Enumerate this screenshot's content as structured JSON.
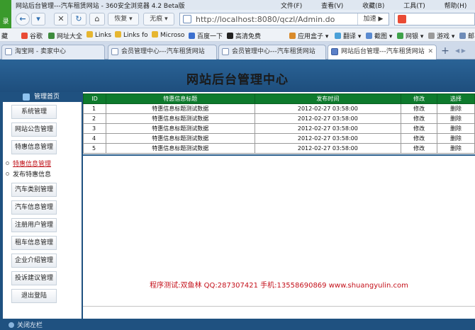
{
  "browser": {
    "window_title": "网站后台管理---汽车租赁网站 - 360安全浏览器 4.2 Beta版",
    "menus": [
      "文件(F)",
      "查看(V)",
      "收藏(B)",
      "工具(T)",
      "帮助(H)"
    ],
    "login_label": "录",
    "back_icon": "back-arrow-icon",
    "forward_icon": "forward-arrow-icon",
    "stop_icon": "close-icon",
    "refresh_icon": "refresh-icon",
    "home_icon": "home-icon",
    "restore_label": "恢复",
    "no_trace_label": "无痕",
    "address_url": "http://localhost:8080/qczl/Admin.do",
    "accelerate_label": "加速",
    "search_value": ""
  },
  "favorites": {
    "items": [
      "藏",
      "谷歌",
      "网址大全",
      "Links",
      "Links fo",
      "Microso",
      "百度一下",
      "高清免费",
      "应用盒子",
      "翻译",
      "截图",
      "网银",
      "游戏",
      "邮"
    ]
  },
  "tabs": [
    {
      "label": "淘宝网 - 卖家中心",
      "active": false
    },
    {
      "label": "会员管理中心---汽车租赁网站",
      "active": false
    },
    {
      "label": "会员管理中心---汽车租赁网站",
      "active": false
    },
    {
      "label": "网站后台管理---汽车租赁网站",
      "active": true
    }
  ],
  "page": {
    "title": "网站后台管理中心",
    "sidebar_header": "管理首页",
    "sidebar": {
      "items": [
        {
          "label": "系统管理"
        },
        {
          "label": "网站公告管理"
        },
        {
          "label": "特惠信息管理"
        }
      ],
      "sub_items": [
        {
          "label": "特惠信息管理",
          "current": true
        },
        {
          "label": "发布特惠信息",
          "current": false
        }
      ],
      "items_after": [
        {
          "label": "汽车类别管理"
        },
        {
          "label": "汽车信息管理"
        },
        {
          "label": "注册用户管理"
        },
        {
          "label": "租车信息管理"
        },
        {
          "label": "企业介绍管理"
        },
        {
          "label": "投诉建议管理"
        },
        {
          "label": "退出登陆"
        }
      ]
    },
    "table": {
      "headers": [
        "ID",
        "特惠信息标题",
        "发布时间",
        "修改",
        "选择"
      ],
      "rows": [
        {
          "id": "1",
          "title": "特惠信息标题测试数据",
          "time": "2012-02-27 03:58:00",
          "edit": "修改",
          "delete": "删除"
        },
        {
          "id": "2",
          "title": "特惠信息标题测试数据",
          "time": "2012-02-27 03:58:00",
          "edit": "修改",
          "delete": "删除"
        },
        {
          "id": "3",
          "title": "特惠信息标题测试数据",
          "time": "2012-02-27 03:58:00",
          "edit": "修改",
          "delete": "删除"
        },
        {
          "id": "4",
          "title": "特惠信息标题测试数据",
          "time": "2012-02-27 03:58:00",
          "edit": "修改",
          "delete": "删除"
        },
        {
          "id": "5",
          "title": "特惠信息标题测试数据",
          "time": "2012-02-27 03:58:00",
          "edit": "修改",
          "delete": "删除"
        }
      ]
    },
    "credits": "程序测试:双鱼林 QQ:287307421 手机:13558690869 www.shuangyulin.com",
    "footer": "关闭左栏"
  },
  "colors": {
    "page_background": "#1f5180",
    "table_header": "#0e7a2d",
    "credits_text": "#c4101a",
    "current_menu": "#c0141c"
  }
}
